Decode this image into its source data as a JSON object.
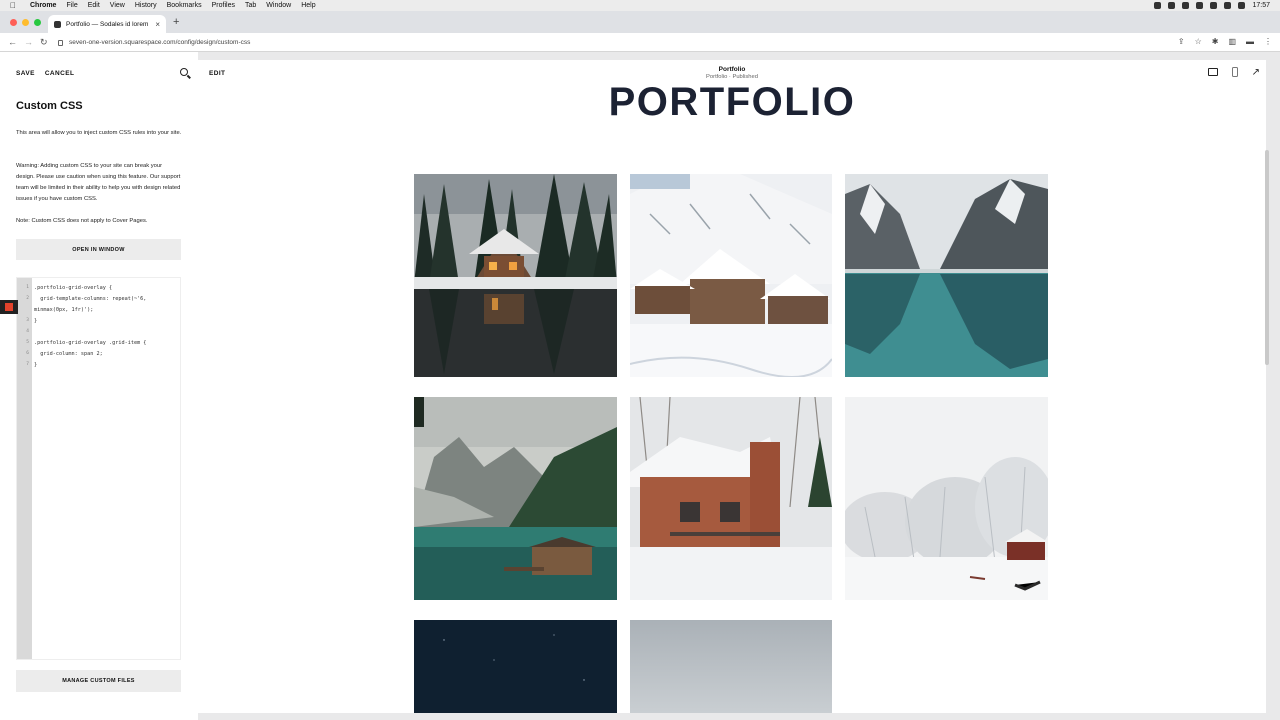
{
  "menubar": {
    "app": "Chrome",
    "items": [
      "File",
      "Edit",
      "View",
      "History",
      "Bookmarks",
      "Profiles",
      "Tab",
      "Window",
      "Help"
    ],
    "clock": "17:57"
  },
  "browser": {
    "tab_title": "Portfolio — Sodales id lorem",
    "url": "seven-one-version.squarespace.com/config/design/custom-css"
  },
  "panel": {
    "save": "SAVE",
    "cancel": "CANCEL",
    "title": "Custom CSS",
    "intro": "This area will allow you to inject custom CSS rules into your site.",
    "warning": "Warning: Adding custom CSS to your site can break your design. Please use caution when using this feature. Our support team will be limited in their ability to help you with design related issues if you have custom CSS.",
    "note": "Note: Custom CSS does not apply to Cover Pages.",
    "open_window": "OPEN IN WINDOW",
    "manage_files": "MANAGE CUSTOM FILES",
    "code_lines": [
      ".portfolio-grid-overlay {",
      "  grid-template-columns: repeat(~'6,",
      "minmax(0px, 1fr)');",
      "}",
      "",
      ".portfolio-grid-overlay .grid-item {",
      "  grid-column: span 2;",
      "}"
    ],
    "line_numbers": [
      "1",
      "2",
      "",
      "3",
      "4",
      "5",
      "6",
      "7"
    ]
  },
  "preview": {
    "edit": "EDIT",
    "page_title": "Portfolio",
    "page_status": "Portfolio · Published",
    "heading": "PORTFOLIO"
  },
  "gallery": [
    {
      "name": "cabin-lake-forest",
      "desc": "lit cabin among snowy pines reflected in lake"
    },
    {
      "name": "snowy-chalets",
      "desc": "snow covered chalets on mountain slope"
    },
    {
      "name": "mountain-lake",
      "desc": "turquoise lake reflecting snowy mountains"
    },
    {
      "name": "boathouse-lake",
      "desc": "boathouse on green alpine lake"
    },
    {
      "name": "red-cabin-snow",
      "desc": "red wooden cabin in deep snow"
    },
    {
      "name": "snowy-field",
      "desc": "white snowy trees and red hut"
    },
    {
      "name": "night-sky",
      "desc": "dark starry sky"
    },
    {
      "name": "grey-sky",
      "desc": "overcast grey sky"
    }
  ]
}
